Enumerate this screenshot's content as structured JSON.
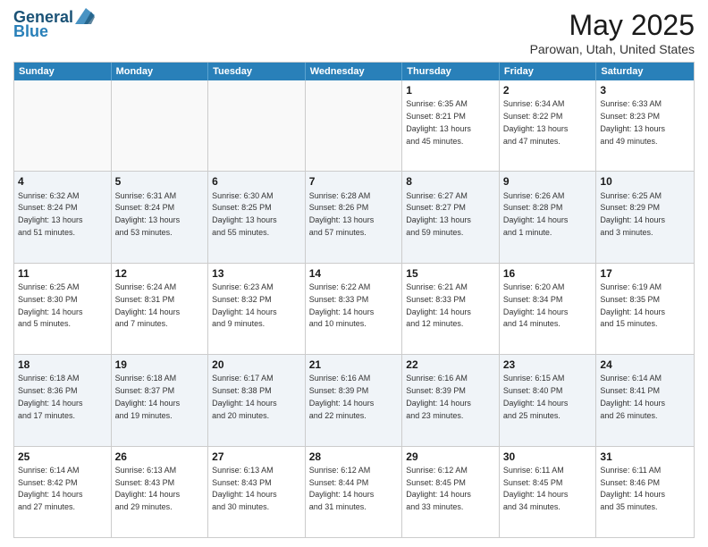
{
  "logo": {
    "line1": "General",
    "line2": "Blue"
  },
  "title": "May 2025",
  "subtitle": "Parowan, Utah, United States",
  "days": [
    "Sunday",
    "Monday",
    "Tuesday",
    "Wednesday",
    "Thursday",
    "Friday",
    "Saturday"
  ],
  "rows": [
    [
      {
        "day": "",
        "info": ""
      },
      {
        "day": "",
        "info": ""
      },
      {
        "day": "",
        "info": ""
      },
      {
        "day": "",
        "info": ""
      },
      {
        "day": "1",
        "info": "Sunrise: 6:35 AM\nSunset: 8:21 PM\nDaylight: 13 hours\nand 45 minutes."
      },
      {
        "day": "2",
        "info": "Sunrise: 6:34 AM\nSunset: 8:22 PM\nDaylight: 13 hours\nand 47 minutes."
      },
      {
        "day": "3",
        "info": "Sunrise: 6:33 AM\nSunset: 8:23 PM\nDaylight: 13 hours\nand 49 minutes."
      }
    ],
    [
      {
        "day": "4",
        "info": "Sunrise: 6:32 AM\nSunset: 8:24 PM\nDaylight: 13 hours\nand 51 minutes."
      },
      {
        "day": "5",
        "info": "Sunrise: 6:31 AM\nSunset: 8:24 PM\nDaylight: 13 hours\nand 53 minutes."
      },
      {
        "day": "6",
        "info": "Sunrise: 6:30 AM\nSunset: 8:25 PM\nDaylight: 13 hours\nand 55 minutes."
      },
      {
        "day": "7",
        "info": "Sunrise: 6:28 AM\nSunset: 8:26 PM\nDaylight: 13 hours\nand 57 minutes."
      },
      {
        "day": "8",
        "info": "Sunrise: 6:27 AM\nSunset: 8:27 PM\nDaylight: 13 hours\nand 59 minutes."
      },
      {
        "day": "9",
        "info": "Sunrise: 6:26 AM\nSunset: 8:28 PM\nDaylight: 14 hours\nand 1 minute."
      },
      {
        "day": "10",
        "info": "Sunrise: 6:25 AM\nSunset: 8:29 PM\nDaylight: 14 hours\nand 3 minutes."
      }
    ],
    [
      {
        "day": "11",
        "info": "Sunrise: 6:25 AM\nSunset: 8:30 PM\nDaylight: 14 hours\nand 5 minutes."
      },
      {
        "day": "12",
        "info": "Sunrise: 6:24 AM\nSunset: 8:31 PM\nDaylight: 14 hours\nand 7 minutes."
      },
      {
        "day": "13",
        "info": "Sunrise: 6:23 AM\nSunset: 8:32 PM\nDaylight: 14 hours\nand 9 minutes."
      },
      {
        "day": "14",
        "info": "Sunrise: 6:22 AM\nSunset: 8:33 PM\nDaylight: 14 hours\nand 10 minutes."
      },
      {
        "day": "15",
        "info": "Sunrise: 6:21 AM\nSunset: 8:33 PM\nDaylight: 14 hours\nand 12 minutes."
      },
      {
        "day": "16",
        "info": "Sunrise: 6:20 AM\nSunset: 8:34 PM\nDaylight: 14 hours\nand 14 minutes."
      },
      {
        "day": "17",
        "info": "Sunrise: 6:19 AM\nSunset: 8:35 PM\nDaylight: 14 hours\nand 15 minutes."
      }
    ],
    [
      {
        "day": "18",
        "info": "Sunrise: 6:18 AM\nSunset: 8:36 PM\nDaylight: 14 hours\nand 17 minutes."
      },
      {
        "day": "19",
        "info": "Sunrise: 6:18 AM\nSunset: 8:37 PM\nDaylight: 14 hours\nand 19 minutes."
      },
      {
        "day": "20",
        "info": "Sunrise: 6:17 AM\nSunset: 8:38 PM\nDaylight: 14 hours\nand 20 minutes."
      },
      {
        "day": "21",
        "info": "Sunrise: 6:16 AM\nSunset: 8:39 PM\nDaylight: 14 hours\nand 22 minutes."
      },
      {
        "day": "22",
        "info": "Sunrise: 6:16 AM\nSunset: 8:39 PM\nDaylight: 14 hours\nand 23 minutes."
      },
      {
        "day": "23",
        "info": "Sunrise: 6:15 AM\nSunset: 8:40 PM\nDaylight: 14 hours\nand 25 minutes."
      },
      {
        "day": "24",
        "info": "Sunrise: 6:14 AM\nSunset: 8:41 PM\nDaylight: 14 hours\nand 26 minutes."
      }
    ],
    [
      {
        "day": "25",
        "info": "Sunrise: 6:14 AM\nSunset: 8:42 PM\nDaylight: 14 hours\nand 27 minutes."
      },
      {
        "day": "26",
        "info": "Sunrise: 6:13 AM\nSunset: 8:43 PM\nDaylight: 14 hours\nand 29 minutes."
      },
      {
        "day": "27",
        "info": "Sunrise: 6:13 AM\nSunset: 8:43 PM\nDaylight: 14 hours\nand 30 minutes."
      },
      {
        "day": "28",
        "info": "Sunrise: 6:12 AM\nSunset: 8:44 PM\nDaylight: 14 hours\nand 31 minutes."
      },
      {
        "day": "29",
        "info": "Sunrise: 6:12 AM\nSunset: 8:45 PM\nDaylight: 14 hours\nand 33 minutes."
      },
      {
        "day": "30",
        "info": "Sunrise: 6:11 AM\nSunset: 8:45 PM\nDaylight: 14 hours\nand 34 minutes."
      },
      {
        "day": "31",
        "info": "Sunrise: 6:11 AM\nSunset: 8:46 PM\nDaylight: 14 hours\nand 35 minutes."
      }
    ]
  ]
}
